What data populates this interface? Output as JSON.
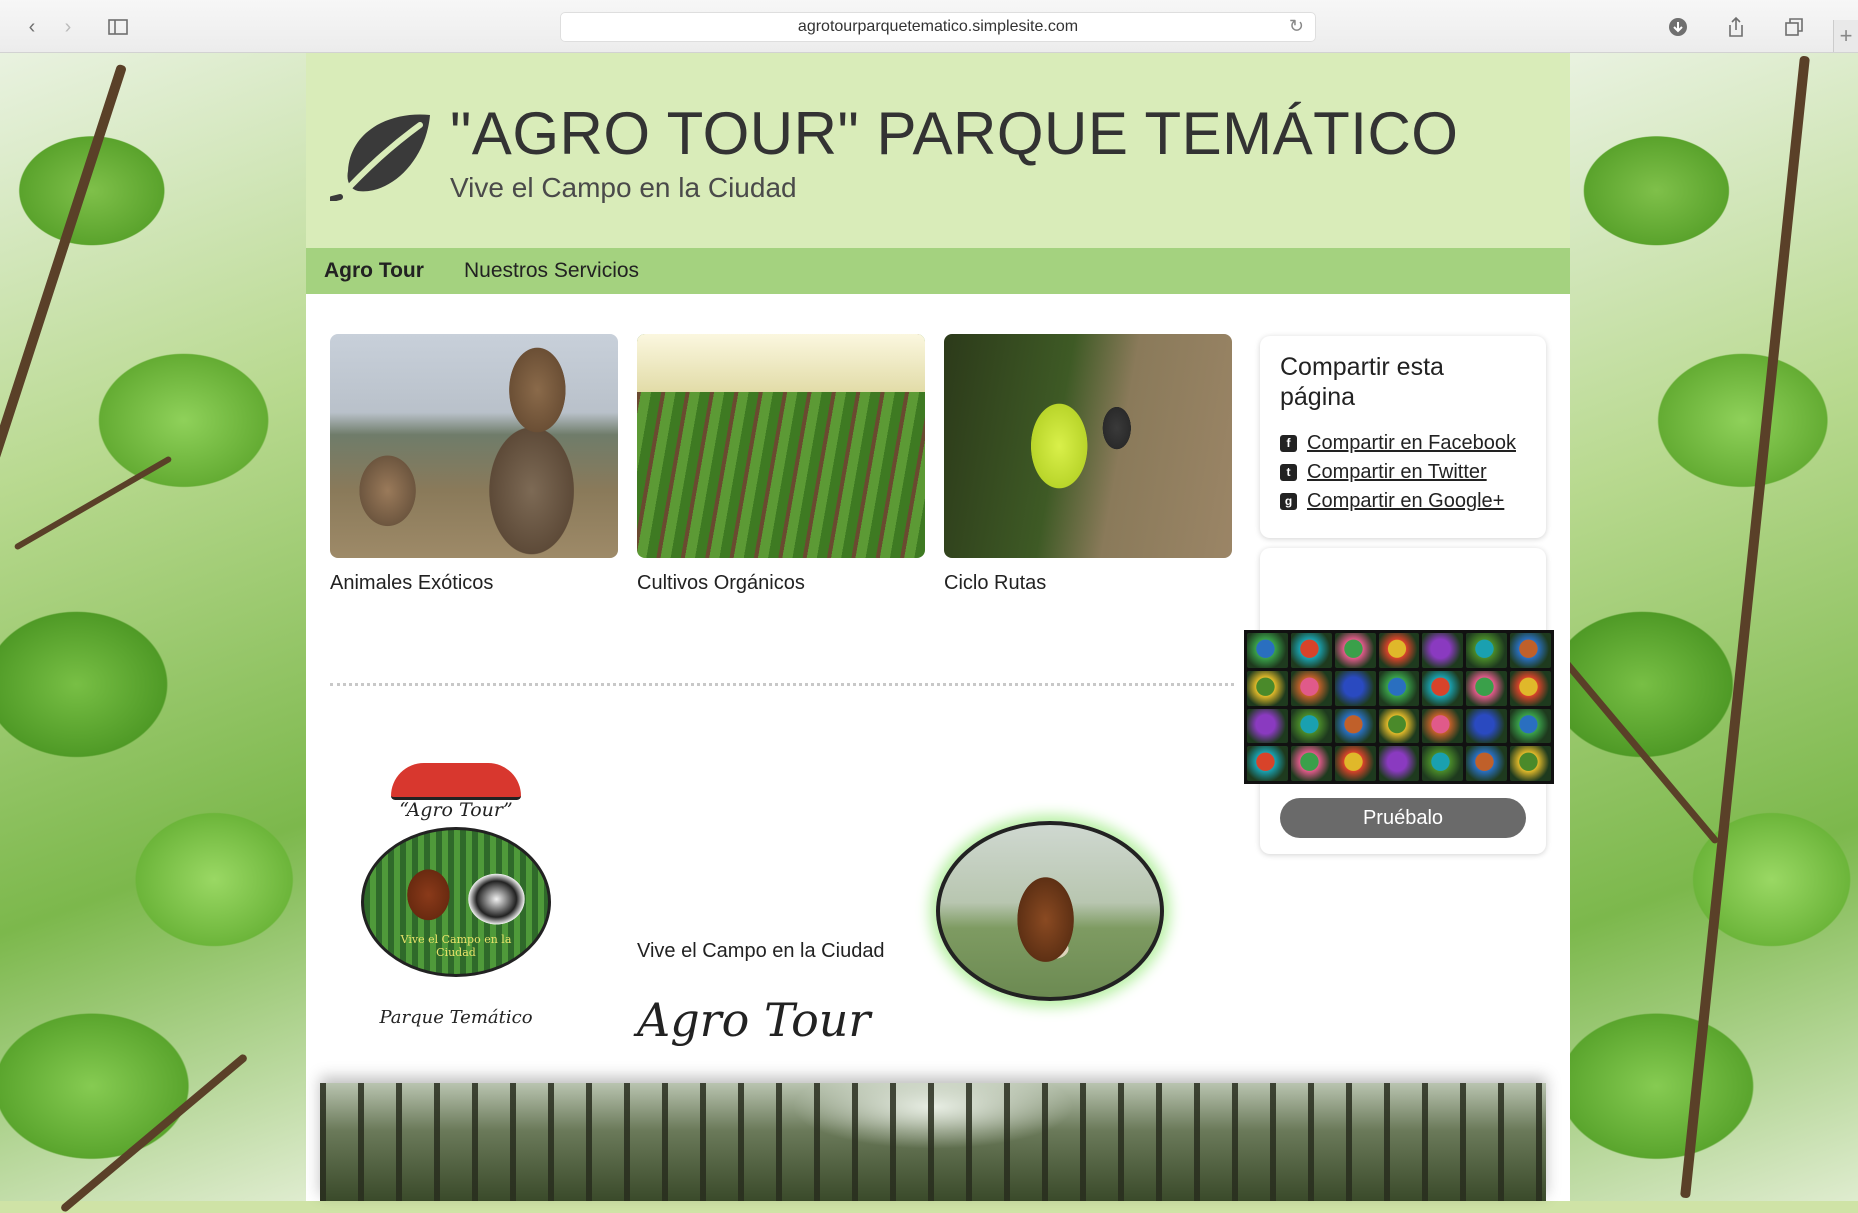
{
  "browser": {
    "url": "agrotourparquetematico.simplesite.com"
  },
  "site": {
    "title": "\"AGRO TOUR\" PARQUE TEMÁTICO",
    "subtitle": "Vive el Campo en la Ciudad"
  },
  "nav": {
    "items": [
      {
        "label": "Agro Tour"
      },
      {
        "label": "Nuestros Servicios"
      }
    ]
  },
  "features": [
    {
      "caption": "Animales Exóticos"
    },
    {
      "caption": "Cultivos Orgánicos"
    },
    {
      "caption": "Ciclo Rutas"
    }
  ],
  "share": {
    "title": "Compartir esta página",
    "facebook": "Compartir en Facebook",
    "twitter": "Compartir en Twitter",
    "google": "Compartir en Google+"
  },
  "promo": {
    "button": "Pruébalo"
  },
  "badge": {
    "top": "“Agro Tour”",
    "ribbon": "Vive el Campo en la Ciudad",
    "bottom": "Parque Temático"
  },
  "main": {
    "tagline": "Vive el Campo en la Ciudad",
    "script": "Agro Tour"
  }
}
